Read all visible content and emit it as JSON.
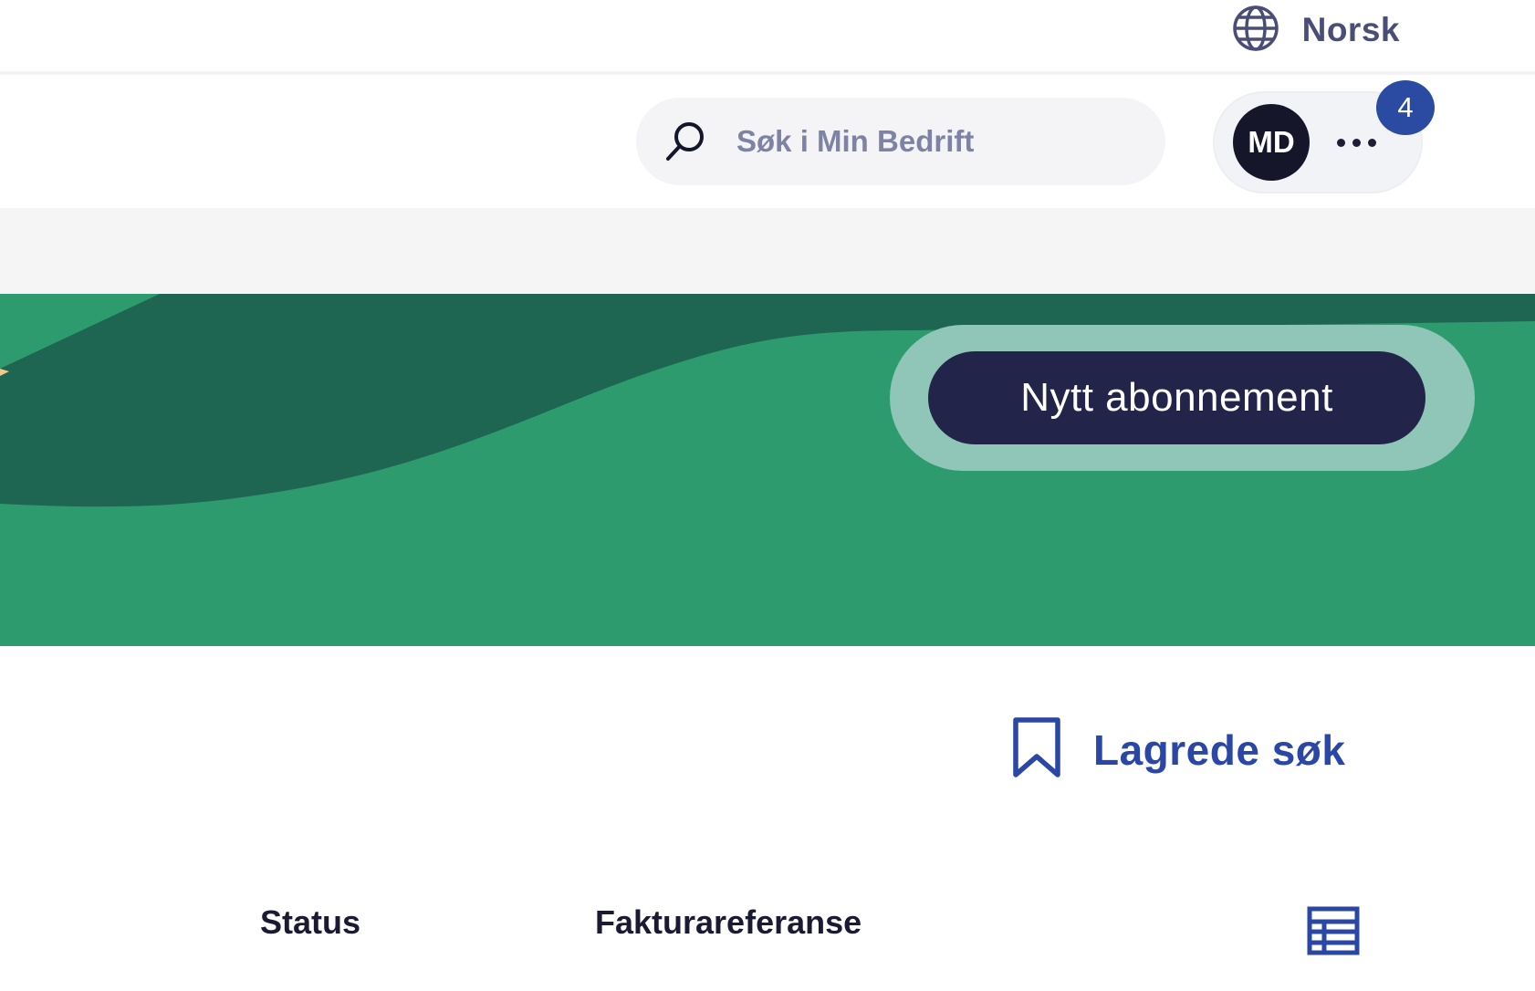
{
  "language": {
    "label": "Norsk",
    "icon": "globe-icon"
  },
  "search": {
    "placeholder": "Søk i Min Bedrift",
    "icon": "search-icon"
  },
  "user": {
    "initials": "MD",
    "notification_count": "4",
    "more_icon": "more-horizontal-icon"
  },
  "banner": {
    "cta_label": "Nytt abonnement"
  },
  "saved_searches": {
    "label": "Lagrede søk",
    "icon": "bookmark-icon"
  },
  "table": {
    "columns": [
      "Status",
      "Fakturareferanse"
    ],
    "view_icon": "table-view-icon"
  },
  "colors": {
    "banner_green": "#2e9b6e",
    "banner_dark_green": "#1e6651",
    "cta_background": "#222449",
    "link_blue": "#2b47a5",
    "badge_blue": "#2b4aa2"
  }
}
